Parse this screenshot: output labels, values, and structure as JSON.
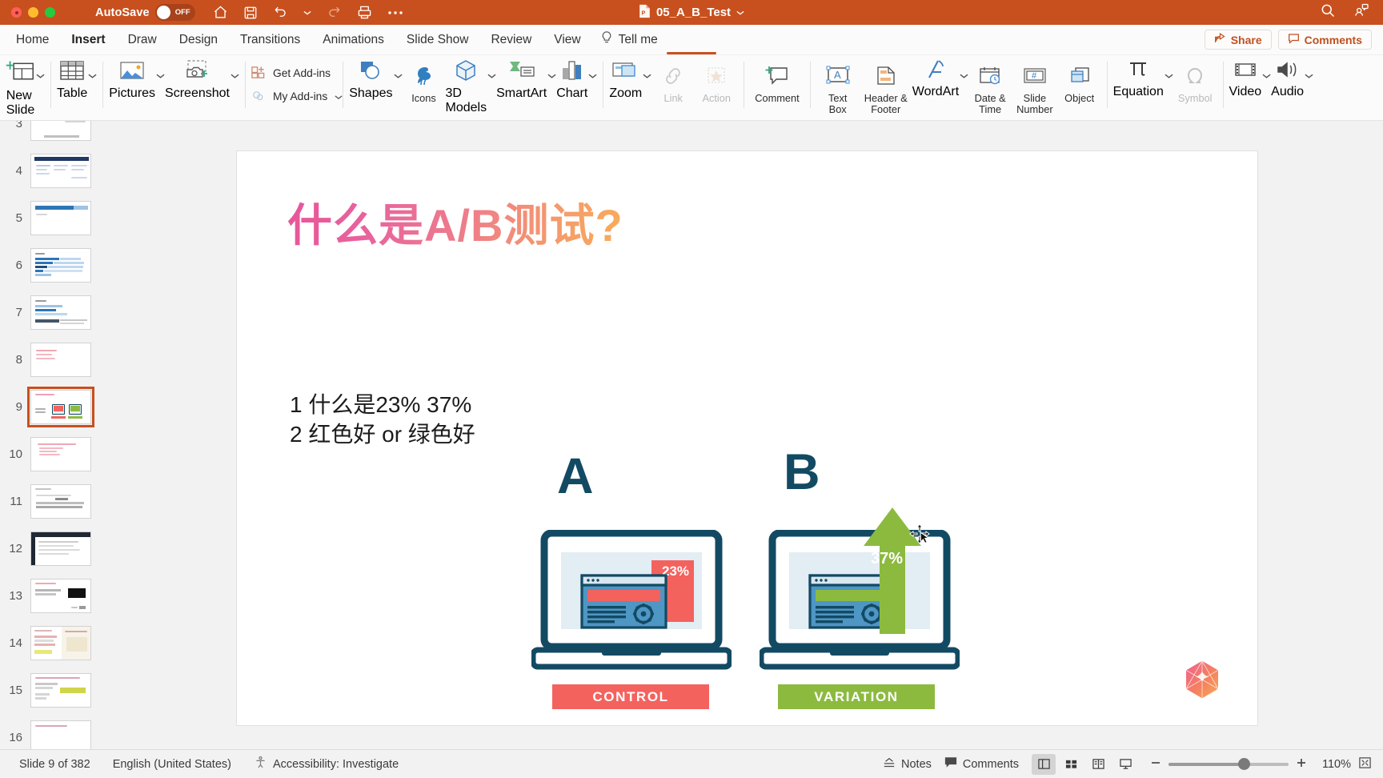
{
  "window": {
    "autosave_label": "AutoSave",
    "autosave_state": "OFF",
    "document_title": "05_A_B_Test",
    "titlebar_color": "#c8501e"
  },
  "titlebar_icons": [
    {
      "name": "home-icon",
      "glyph": "home"
    },
    {
      "name": "save-icon",
      "glyph": "save"
    },
    {
      "name": "undo-icon",
      "glyph": "undo"
    },
    {
      "name": "undo-dropdown-icon",
      "glyph": "chevron"
    },
    {
      "name": "redo-icon",
      "glyph": "redo"
    },
    {
      "name": "print-icon",
      "glyph": "print"
    },
    {
      "name": "more-icon",
      "glyph": "ellipsis"
    }
  ],
  "titlebar_right": [
    {
      "name": "search-icon",
      "glyph": "search"
    },
    {
      "name": "collaborators-icon",
      "glyph": "people"
    }
  ],
  "tabs": [
    {
      "label": "Home",
      "active": false
    },
    {
      "label": "Insert",
      "active": true
    },
    {
      "label": "Draw",
      "active": false
    },
    {
      "label": "Design",
      "active": false
    },
    {
      "label": "Transitions",
      "active": false
    },
    {
      "label": "Animations",
      "active": false
    },
    {
      "label": "Slide Show",
      "active": false
    },
    {
      "label": "Review",
      "active": false
    },
    {
      "label": "View",
      "active": false
    }
  ],
  "tellme": {
    "label": "Tell me"
  },
  "tab_actions": [
    {
      "label": "Share",
      "icon": "share-icon"
    },
    {
      "label": "Comments",
      "icon": "comment-icon"
    }
  ],
  "ribbon": {
    "groups": [
      {
        "name": "slides",
        "items": [
          {
            "label": "New\nSlide",
            "label_line1": "New",
            "label_line2": "Slide",
            "icon": "new-slide-icon",
            "dropdown": true,
            "disabled": false
          }
        ]
      },
      {
        "name": "tables",
        "items": [
          {
            "label": "Table",
            "icon": "table-icon",
            "dropdown": true,
            "disabled": false
          }
        ]
      },
      {
        "name": "images",
        "items": [
          {
            "label": "Pictures",
            "icon": "pictures-icon",
            "dropdown": true,
            "disabled": false
          },
          {
            "label": "Screenshot",
            "icon": "screenshot-icon",
            "dropdown": true,
            "disabled": false
          }
        ]
      },
      {
        "name": "addins",
        "items": [
          {
            "label": "Get Add-ins",
            "icon": "get-addins-icon",
            "dropdown": false,
            "disabled": false
          },
          {
            "label": "My Add-ins",
            "icon": "my-addins-icon",
            "dropdown": true,
            "disabled": false
          }
        ]
      },
      {
        "name": "illustrations",
        "items": [
          {
            "label": "Shapes",
            "icon": "shapes-icon",
            "dropdown": true,
            "disabled": false
          },
          {
            "label": "Icons",
            "icon": "icons-icon",
            "dropdown": false,
            "disabled": false
          },
          {
            "label": "3D Models",
            "label_line1": "3D",
            "label_line2": "Models",
            "icon": "3d-models-icon",
            "dropdown": true,
            "disabled": false
          },
          {
            "label": "SmartArt",
            "icon": "smartart-icon",
            "dropdown": true,
            "disabled": false
          },
          {
            "label": "Chart",
            "icon": "chart-icon",
            "dropdown": true,
            "disabled": false
          }
        ]
      },
      {
        "name": "links",
        "items": [
          {
            "label": "Zoom",
            "icon": "zoom-icon",
            "dropdown": true,
            "disabled": false
          },
          {
            "label": "Link",
            "icon": "link-icon",
            "dropdown": false,
            "disabled": true
          },
          {
            "label": "Action",
            "icon": "action-icon",
            "dropdown": false,
            "disabled": true
          }
        ]
      },
      {
        "name": "comments",
        "items": [
          {
            "label": "Comment",
            "icon": "new-comment-icon",
            "dropdown": false,
            "disabled": false
          }
        ]
      },
      {
        "name": "text",
        "items": [
          {
            "label": "Text Box",
            "label_line1": "Text",
            "label_line2": "Box",
            "icon": "text-box-icon",
            "dropdown": false,
            "disabled": false
          },
          {
            "label": "Header & Footer",
            "label_line1": "Header &",
            "label_line2": "Footer",
            "icon": "header-footer-icon",
            "dropdown": false,
            "disabled": false
          },
          {
            "label": "WordArt",
            "icon": "wordart-icon",
            "dropdown": true,
            "disabled": false
          },
          {
            "label": "Date & Time",
            "label_line1": "Date &",
            "label_line2": "Time",
            "icon": "date-time-icon",
            "dropdown": false,
            "disabled": false
          },
          {
            "label": "Slide Number",
            "label_line1": "Slide",
            "label_line2": "Number",
            "icon": "slide-number-icon",
            "dropdown": false,
            "disabled": false
          },
          {
            "label": "Object",
            "icon": "object-icon",
            "dropdown": false,
            "disabled": false
          }
        ]
      },
      {
        "name": "symbols",
        "items": [
          {
            "label": "Equation",
            "icon": "equation-icon",
            "dropdown": true,
            "disabled": false
          },
          {
            "label": "Symbol",
            "icon": "symbol-icon",
            "dropdown": false,
            "disabled": true
          }
        ]
      },
      {
        "name": "media",
        "items": [
          {
            "label": "Video",
            "icon": "video-icon",
            "dropdown": true,
            "disabled": false
          },
          {
            "label": "Audio",
            "icon": "audio-icon",
            "dropdown": true,
            "disabled": false
          }
        ]
      }
    ]
  },
  "thumbnails": {
    "selected": 9,
    "items": [
      {
        "number": "3",
        "style": "text-right-col"
      },
      {
        "number": "4",
        "style": "dark-header-two-col"
      },
      {
        "number": "5",
        "style": "blue-bar"
      },
      {
        "number": "6",
        "style": "blue-lines"
      },
      {
        "number": "7",
        "style": "blue-lines-dense"
      },
      {
        "number": "8",
        "style": "pink-lines"
      },
      {
        "number": "9",
        "style": "ab-test"
      },
      {
        "number": "10",
        "style": "pink-lines"
      },
      {
        "number": "11",
        "style": "gray-lines"
      },
      {
        "number": "12",
        "style": "dark-window"
      },
      {
        "number": "13",
        "style": "black-box"
      },
      {
        "number": "14",
        "style": "two-pane-yellow"
      },
      {
        "number": "15",
        "style": "yellow-highlight"
      },
      {
        "number": "16",
        "style": "partial"
      }
    ]
  },
  "slide": {
    "title": "什么是A/B测试?",
    "body_lines": [
      "1 什么是23% 37%",
      "2 红色好 or 绿色好"
    ],
    "illustration": {
      "variant_a": {
        "letter": "A",
        "badge_label": "CONTROL",
        "badge_color": "#f4625e",
        "metric": "23%",
        "accent_color": "#f4625e"
      },
      "variant_b": {
        "letter": "B",
        "badge_label": "VARIATION",
        "badge_color": "#8cba3f",
        "metric": "37%",
        "accent_color": "#8cba3f"
      },
      "frame_color": "#134a63"
    },
    "logo": {
      "name": "hexagon-logo",
      "colors": [
        "#f06292",
        "#f8a05a"
      ]
    }
  },
  "statusbar": {
    "slide_counter": "Slide 9 of 382",
    "language": "English (United States)",
    "accessibility": "Accessibility: Investigate",
    "notes_label": "Notes",
    "comments_label": "Comments",
    "zoom_level": "110%",
    "views": [
      {
        "name": "normal-view-button",
        "active": true
      },
      {
        "name": "slide-sorter-view-button",
        "active": false
      },
      {
        "name": "reading-view-button",
        "active": false
      },
      {
        "name": "slideshow-view-button",
        "active": false
      }
    ]
  }
}
